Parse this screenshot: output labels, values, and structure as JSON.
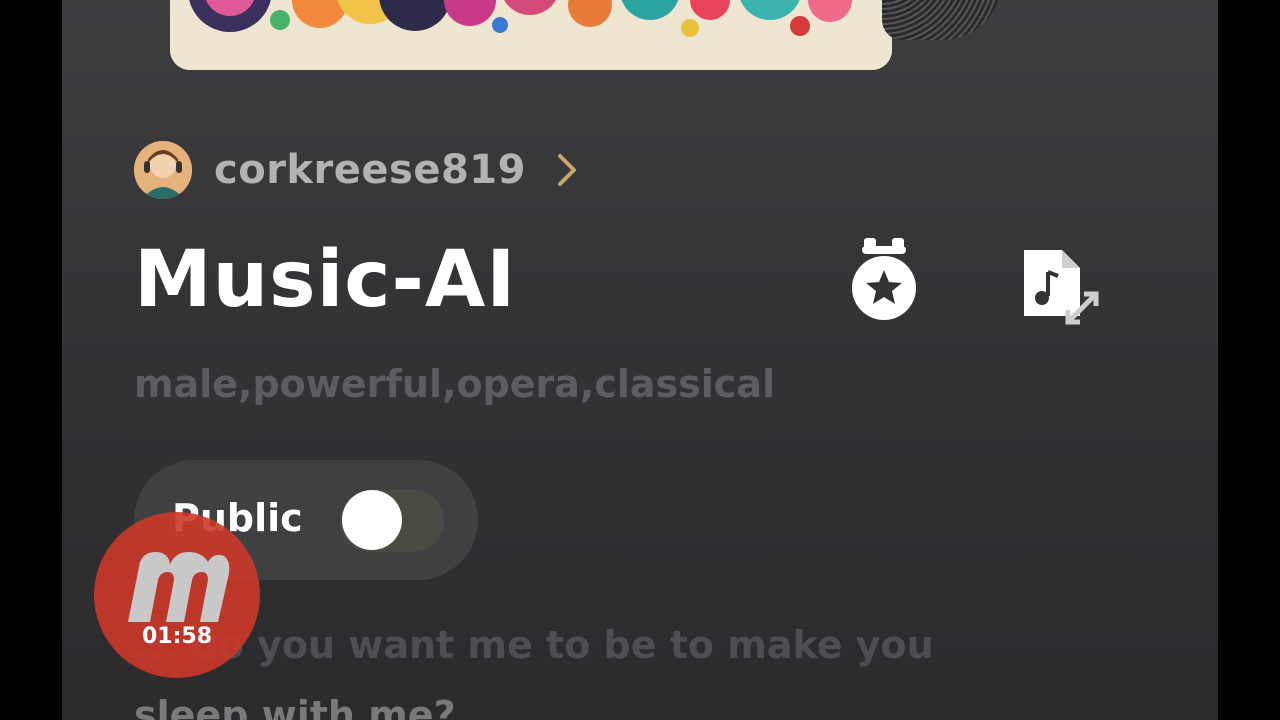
{
  "author": {
    "username": "corkreese819"
  },
  "song": {
    "title": "Music-AI",
    "tags": "male,powerful,opera,classical"
  },
  "visibility": {
    "label": "Public",
    "on": false
  },
  "lyrics": {
    "line1": "... do you want me to be to make you",
    "line2": "sleep with me?"
  },
  "recorder": {
    "time": "01:58"
  },
  "icons": {
    "medal": "medal-star-icon",
    "audio": "audio-file-expand-icon",
    "chevron": "chevron-right-icon",
    "recorder_logo": "m-logo-icon"
  },
  "colors": {
    "background": "#333336",
    "title": "#ffffff",
    "secondary_text": "#b3b3b3",
    "tags_text": "#5d5d61",
    "chevron_accent": "#c9a56a",
    "recorder_badge": "#cc382a"
  }
}
